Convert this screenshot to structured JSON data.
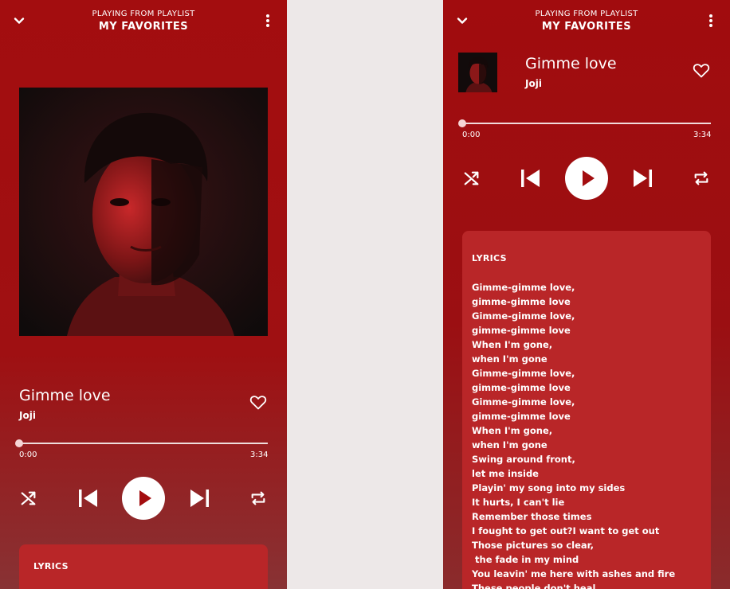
{
  "player": {
    "playing_from": "PLAYING FROM PLAYLIST",
    "playlist_name": "MY FAVORITES",
    "song_title": "Gimme love",
    "artist": "Joji",
    "time_current": "0:00",
    "time_total": "3:34",
    "progress": 0,
    "favorited": false
  },
  "icons": {
    "collapse": "chevron-down-icon",
    "menu": "more-vertical-icon",
    "favorite": "heart-outline-icon",
    "shuffle": "shuffle-icon",
    "previous": "skip-previous-icon",
    "play": "play-icon",
    "next": "skip-next-icon",
    "repeat": "repeat-icon"
  },
  "lyrics": {
    "heading": "LYRICS",
    "lines": [
      "Gimme-gimme love,",
      "gimme-gimme love",
      "Gimme-gimme love,",
      "gimme-gimme love",
      "When I'm gone,",
      "when I'm gone",
      "Gimme-gimme love,",
      "gimme-gimme love",
      "Gimme-gimme love,",
      "gimme-gimme love",
      "When I'm gone,",
      "when I'm gone",
      "Swing around front,",
      "let me inside",
      "Playin' my song into my sides",
      "It hurts, I can't lie",
      "Remember those times",
      "I fought to get out?I want to get out",
      "Those pictures so clear,",
      " the fade in my mind",
      "You leavin' me here with ashes and fire",
      "These people don't heal"
    ]
  },
  "colors": {
    "background": "#ede8e8",
    "player_red": "#a30d0f",
    "card_red": "#b92628",
    "accent_knob": "#f6d5d5"
  }
}
